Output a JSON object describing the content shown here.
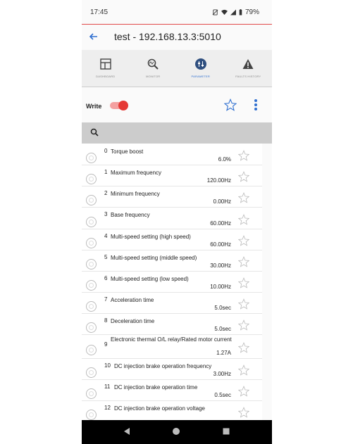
{
  "status": {
    "time": "17:45",
    "battery": "79%"
  },
  "appbar": {
    "title": "test - 192.168.13.3:5010"
  },
  "tabs": [
    {
      "label": "DASHBOARD",
      "icon": "dashboard-icon"
    },
    {
      "label": "MONITOR",
      "icon": "monitor-icon"
    },
    {
      "label": "PARAMETER",
      "icon": "parameter-icon",
      "active": true
    },
    {
      "label": "FAULTS HISTORY",
      "icon": "warning-icon"
    }
  ],
  "toolbar": {
    "write_label": "Write",
    "write_enabled": true
  },
  "search": {
    "placeholder": ""
  },
  "parameters": [
    {
      "num": "0",
      "name": "Torque boost",
      "value": "6.0%"
    },
    {
      "num": "1",
      "name": "Maximum frequency",
      "value": "120.00Hz"
    },
    {
      "num": "2",
      "name": "Minimum frequency",
      "value": "0.00Hz"
    },
    {
      "num": "3",
      "name": "Base frequency",
      "value": "60.00Hz"
    },
    {
      "num": "4",
      "name": "Multi-speed setting (high speed)",
      "value": "60.00Hz"
    },
    {
      "num": "5",
      "name": "Multi-speed setting (middle speed)",
      "value": "30.00Hz"
    },
    {
      "num": "6",
      "name": "Multi-speed setting (low speed)",
      "value": "10.00Hz"
    },
    {
      "num": "7",
      "name": "Acceleration time",
      "value": "5.0sec"
    },
    {
      "num": "8",
      "name": "Deceleration time",
      "value": "5.0sec"
    },
    {
      "num": "9",
      "name": "Electronic thermal O/L relay/Rated motor current",
      "value": "1.27A"
    },
    {
      "num": "10",
      "name": "DC injection brake operation frequency",
      "value": "3.00Hz"
    },
    {
      "num": "11",
      "name": "DC injection brake operation time",
      "value": "0.5sec"
    },
    {
      "num": "12",
      "name": "DC injection brake operation voltage",
      "value": ""
    }
  ],
  "colors": {
    "accent": "#2f6fd0",
    "switch_on": "#e53935",
    "divider": "#e24a4a"
  }
}
